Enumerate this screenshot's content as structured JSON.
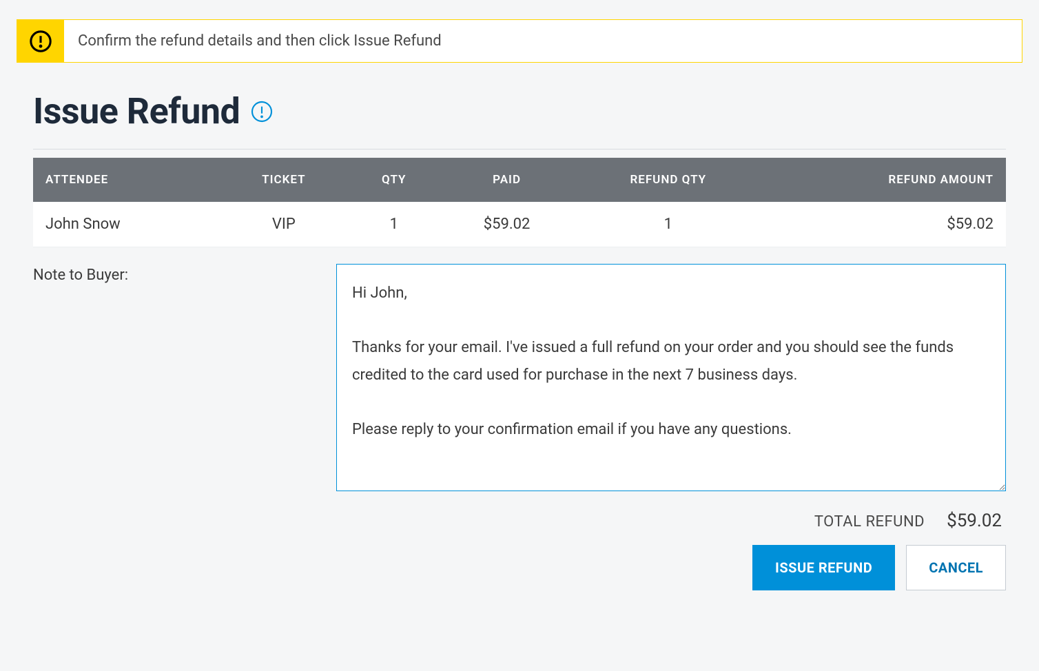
{
  "alert": {
    "message": "Confirm the refund details and then click Issue Refund"
  },
  "page": {
    "title": "Issue Refund"
  },
  "table": {
    "headers": {
      "attendee": "ATTENDEE",
      "ticket": "TICKET",
      "qty": "QTY",
      "paid": "PAID",
      "refund_qty": "REFUND QTY",
      "refund_amount": "REFUND AMOUNT"
    },
    "rows": [
      {
        "attendee": "John Snow",
        "ticket": "VIP",
        "qty": "1",
        "paid": "$59.02",
        "refund_qty": "1",
        "refund_amount": "$59.02"
      }
    ]
  },
  "note": {
    "label": "Note to Buyer:",
    "value": "Hi John,\n\nThanks for your email. I've issued a full refund on your order and you should see the funds credited to the card used for purchase in the next 7 business days.\n\nPlease reply to your confirmation email if you have any questions."
  },
  "total": {
    "label": "TOTAL REFUND",
    "amount": "$59.02"
  },
  "buttons": {
    "issue": "ISSUE REFUND",
    "cancel": "CANCEL"
  }
}
